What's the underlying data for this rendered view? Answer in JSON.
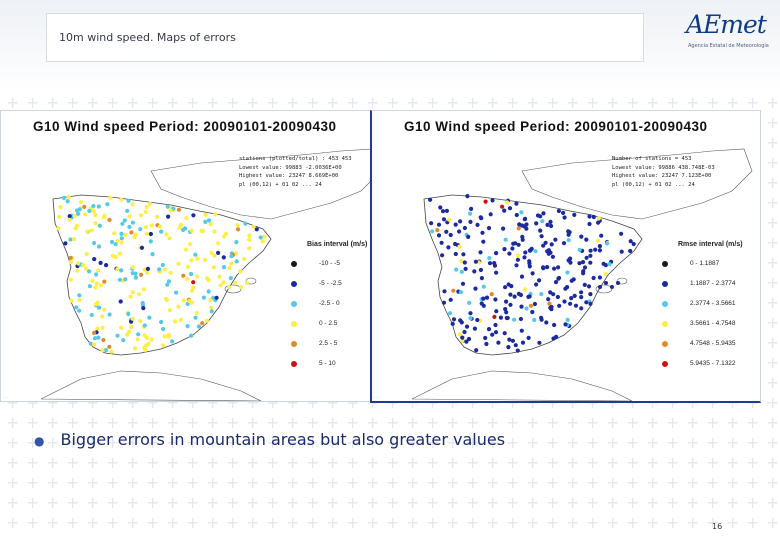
{
  "header": {
    "title": "10m wind speed. Maps of errors"
  },
  "logo": {
    "word": "AEmet",
    "subtitle": "Agencia Estatal de Meteorología"
  },
  "maps": [
    {
      "title": "G10  Wind speed  Period: 20090101-20090430",
      "stats": [
        "stations (plotted/total) :   453    453",
        " Lowest value:  99883   -2.0036E+00",
        "Highest value:  23247    8.669E+00",
        "pl (00,12) + 01 02 ... 24"
      ],
      "legend_title": "Bias interval (m/s)",
      "legend": [
        {
          "label": "-10 - -5",
          "color": "#1a1a1a"
        },
        {
          "label": "-5 - -2.5",
          "color": "#1b2a9e"
        },
        {
          "label": "-2.5 - 0",
          "color": "#56c8e8"
        },
        {
          "label": "0 - 2.5",
          "color": "#ffee44"
        },
        {
          "label": "2.5 - 5",
          "color": "#e08a2a"
        },
        {
          "label": "5 - 10",
          "color": "#cc1111"
        }
      ]
    },
    {
      "title": "G10  Wind speed  Period: 20090101-20090430",
      "stats": [
        "Number of stations =        453",
        " Lowest value:  99886   438.748E-03",
        "Highest value:  23247    7.123E+00",
        "pl (00,12) + 01 02 ... 24"
      ],
      "legend_title": "Rmse interval (m/s)",
      "legend": [
        {
          "label": "0 - 1.1887",
          "color": "#1a1a1a"
        },
        {
          "label": "1.1887 - 2.3774",
          "color": "#1b2a9e"
        },
        {
          "label": "2.3774 - 3.5661",
          "color": "#56c8e8"
        },
        {
          "label": "3.5661 - 4.7548",
          "color": "#ffee44"
        },
        {
          "label": "4.7548 - 5.9435",
          "color": "#e08a2a"
        },
        {
          "label": "5.9435 - 7.1322",
          "color": "#cc1111"
        }
      ]
    }
  ],
  "bullet": "Bigger errors in mountain areas but also greater values",
  "page_number": "16"
}
